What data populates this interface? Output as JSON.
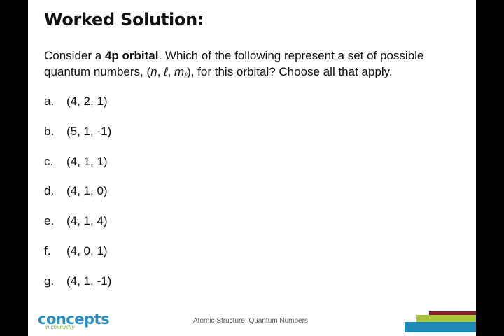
{
  "slide": {
    "title": "Worked Solution:",
    "prompt": {
      "part1": "Consider a ",
      "bold": "4p orbital",
      "part2": ". Which of the following represent a set of possible quantum numbers, (",
      "n": "n",
      "sep1": ", ",
      "l": "ℓ",
      "sep2": ", ",
      "m": "m",
      "m_sub": "ℓ",
      "part3": "), for this orbital? Choose all that apply."
    },
    "options": [
      {
        "letter": "a.",
        "value": "(4, 2, 1)"
      },
      {
        "letter": "b.",
        "value": "(5, 1, -1)"
      },
      {
        "letter": "c.",
        "value": "(4, 1, 1)"
      },
      {
        "letter": "d.",
        "value": "(4, 1, 0)"
      },
      {
        "letter": "e.",
        "value": "(4, 1, 4)"
      },
      {
        "letter": "f.",
        "value": "(4, 0, 1)"
      },
      {
        "letter": "g.",
        "value": "(4, 1, -1)"
      }
    ]
  },
  "footer": {
    "logo_word": "concepts",
    "logo_sub": "in chemistry",
    "topic": "Atomic Structure: Quantum Numbers"
  },
  "colors": {
    "logo_blue": "#2c8fbf",
    "logo_green": "#7cb342",
    "bar_red": "#8b1e2b",
    "bar_green": "#a6c43a",
    "bar_blue": "#1e8ab5"
  }
}
